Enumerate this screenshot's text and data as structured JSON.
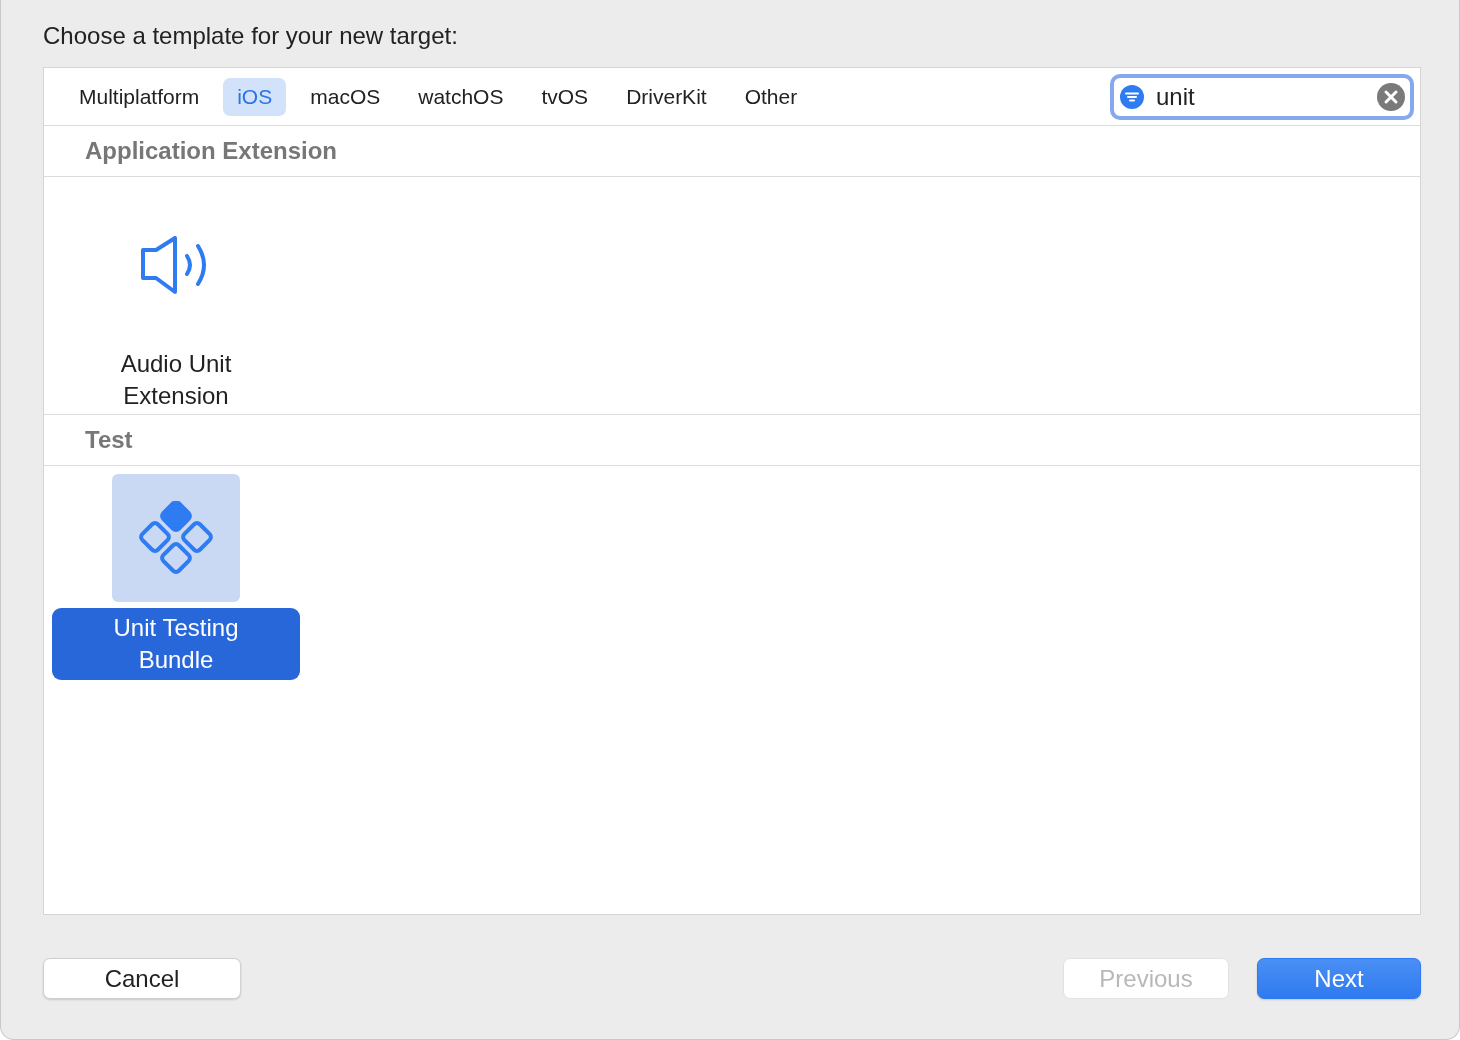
{
  "prompt": "Choose a template for your new target:",
  "tabs": [
    {
      "label": "Multiplatform",
      "selected": false
    },
    {
      "label": "iOS",
      "selected": true
    },
    {
      "label": "macOS",
      "selected": false
    },
    {
      "label": "watchOS",
      "selected": false
    },
    {
      "label": "tvOS",
      "selected": false
    },
    {
      "label": "DriverKit",
      "selected": false
    },
    {
      "label": "Other",
      "selected": false
    }
  ],
  "search": {
    "value": "unit"
  },
  "sections": [
    {
      "title": "Application Extension",
      "templates": [
        {
          "kind": "speaker",
          "label": "Audio Unit Extension",
          "selected": false
        }
      ]
    },
    {
      "title": "Test",
      "templates": [
        {
          "kind": "test",
          "label": "Unit Testing Bundle",
          "selected": true
        }
      ]
    }
  ],
  "buttons": [
    {
      "label": "Cancel",
      "kind": "normal",
      "disabled": false
    },
    {
      "label": "Previous",
      "kind": "normal",
      "disabled": true
    },
    {
      "label": "Next",
      "kind": "default",
      "disabled": false
    }
  ]
}
